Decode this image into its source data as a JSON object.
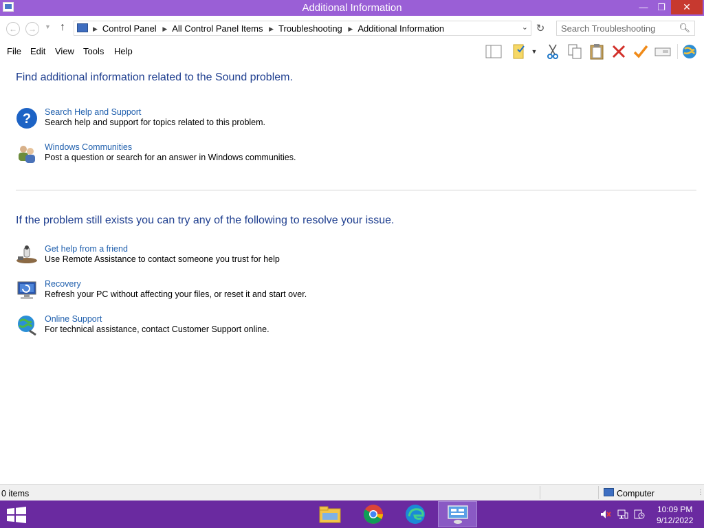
{
  "window": {
    "title": "Additional Information",
    "minimize_glyph": "—",
    "maximize_glyph": "❐",
    "close_glyph": "✕"
  },
  "address_bar": {
    "back_glyph": "←",
    "forward_glyph": "→",
    "up_glyph": "↑",
    "refresh_glyph": "↻",
    "breadcrumbs": [
      "Control Panel",
      "All Control Panel Items",
      "Troubleshooting",
      "Additional Information"
    ],
    "search_placeholder": "Search Troubleshooting"
  },
  "menu": {
    "items": [
      "File",
      "Edit",
      "View",
      "Tools",
      "Help"
    ]
  },
  "toolbar": {
    "icons": [
      "preview-pane-icon",
      "properties-icon",
      "cut-icon",
      "copy-icon",
      "paste-icon",
      "delete-icon",
      "check-icon",
      "rename-icon",
      "globe-icon"
    ]
  },
  "content": {
    "heading1": "Find additional information related to the Sound problem.",
    "section1": [
      {
        "icon": "help-icon",
        "link": "Search Help and Support",
        "desc": "Search help and support for topics related to this problem."
      },
      {
        "icon": "people-icon",
        "link": "Windows Communities",
        "desc": "Post a question or search for an answer in Windows communities."
      }
    ],
    "heading2": "If the problem still exists you can try any of the following to resolve your issue.",
    "section2": [
      {
        "icon": "remote-assistance-icon",
        "link": "Get help from a friend",
        "desc": "Use Remote Assistance to contact someone you trust for help"
      },
      {
        "icon": "recovery-icon",
        "link": "Recovery",
        "desc": "Refresh your PC without affecting your files, or reset it and start over."
      },
      {
        "icon": "online-support-icon",
        "link": "Online Support",
        "desc": "For technical assistance, contact Customer Support online."
      }
    ]
  },
  "status_bar": {
    "items_count": "0 items",
    "location": "Computer"
  },
  "taskbar": {
    "apps": [
      "file-explorer-icon",
      "chrome-icon",
      "edge-icon",
      "control-panel-icon"
    ],
    "clock_time": "10:09 PM",
    "clock_date": "9/12/2022"
  },
  "colors": {
    "titlebar": "#9a5fd6",
    "taskbar": "#6a2aa0",
    "heading": "#1e3e8f",
    "link": "#1f5fad"
  }
}
